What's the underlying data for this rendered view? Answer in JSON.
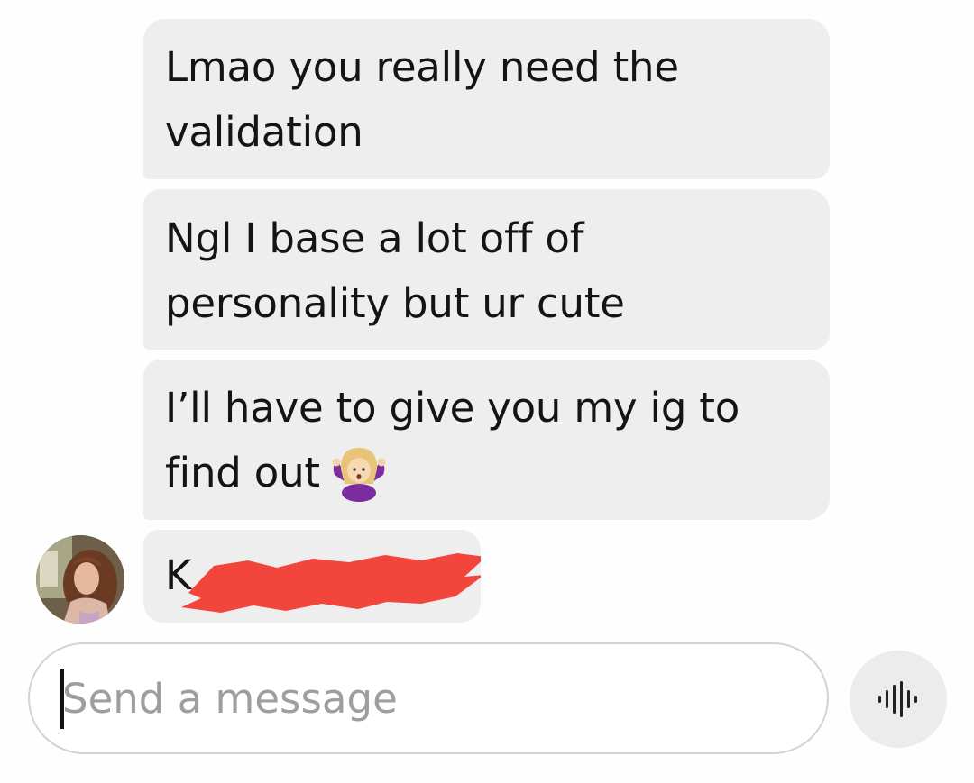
{
  "messages": [
    {
      "lines": [
        "Lmao you really need the",
        "validation"
      ]
    },
    {
      "lines": [
        "Ngl I base a lot off of",
        "personality but ur cute"
      ]
    },
    {
      "lines": [
        "I’ll have to give you my ig to",
        "find out"
      ],
      "emoji": "person-shrugging-emoji"
    },
    {
      "visible_text": "K",
      "redacted": true
    }
  ],
  "input": {
    "placeholder": "Send a message"
  },
  "icons": {
    "voice": "voice-waveform-icon",
    "avatar": "contact-avatar"
  },
  "colors": {
    "bubble": "#eeeeef",
    "redaction": "#f2453b",
    "placeholder": "#9e9e9e"
  }
}
